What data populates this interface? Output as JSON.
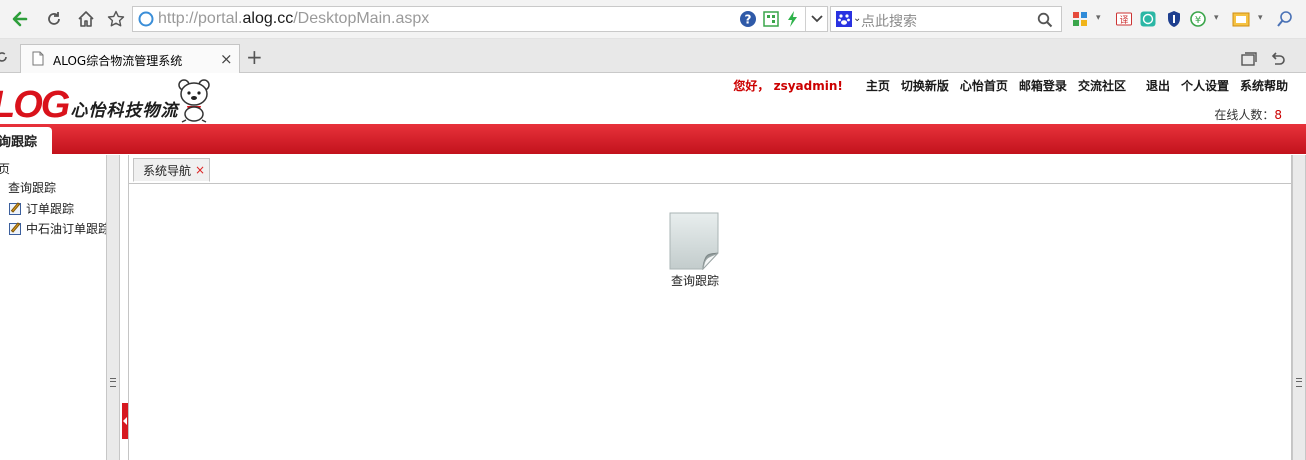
{
  "browser": {
    "url_prefix": "http://portal.",
    "url_domain": "alog.cc",
    "url_path": "/DesktopMain.aspx",
    "search_placeholder": "点此搜索",
    "tab_title": "ALOG综合物流管理系统",
    "new_tab_label": "+"
  },
  "header": {
    "logo_text": "LOG",
    "logo_cn": "心怡科技物流",
    "greeting": "您好， zsyadmin!",
    "nav": [
      "主页",
      "切换新版",
      "心怡首页",
      "邮箱登录",
      "交流社区",
      "退出",
      "个人设置",
      "系统帮助"
    ],
    "online_label": "在线人数：",
    "online_count": "8"
  },
  "menubar": {
    "active_item": "询跟踪"
  },
  "sidebar": {
    "root_fragment": "页",
    "group": "查询跟踪",
    "items": [
      {
        "label": "订单跟踪",
        "icon": "edit-icon"
      },
      {
        "label": "中石油订单跟踪",
        "icon": "edit-icon"
      }
    ]
  },
  "main": {
    "tab_label": "系统导航",
    "tab_close": "×",
    "desktop_icons": [
      {
        "label": "查询跟踪",
        "icon": "document-icon"
      }
    ]
  },
  "colors": {
    "brand_red": "#d9121b",
    "menubar_red": "#d41c24",
    "greeting_red": "#cc0000"
  }
}
